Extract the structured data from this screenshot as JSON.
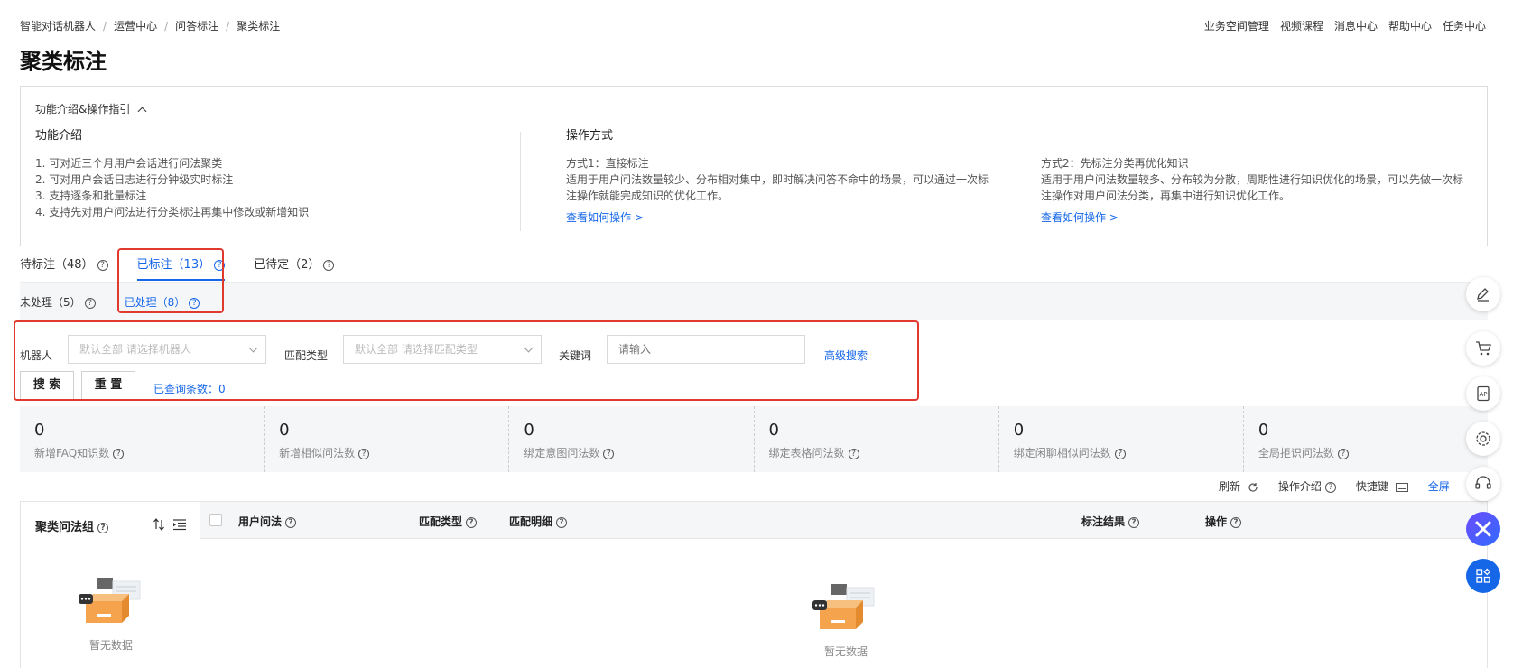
{
  "breadcrumb": [
    "智能对话机器人",
    "运营中心",
    "问答标注",
    "聚类标注"
  ],
  "top_links": [
    "业务空间管理",
    "视频课程",
    "消息中心",
    "帮助中心",
    "任务中心"
  ],
  "page_title": "聚类标注",
  "intro": {
    "toggle_label": "功能介绍&操作指引",
    "features": {
      "heading": "功能介绍",
      "items": [
        "1. 可对近三个月用户会话进行问法聚类",
        "2. 可对用户会话日志进行分钟级实时标注",
        "3. 支持逐条和批量标注",
        "4. 支持先对用户问法进行分类标注再集中修改或新增知识"
      ]
    },
    "operations": {
      "heading": "操作方式",
      "method1": {
        "title": "方式1：直接标注",
        "desc1": "适用于用户问法数量较少、分布相对集中，即时解决问答不命中的场景，可以通过一次标",
        "desc2": "注操作就能完成知识的优化工作。",
        "link": "查看如何操作 >"
      },
      "method2": {
        "title": "方式2：先标注分类再优化知识",
        "desc1": "适用于用户问法数量较多、分布较为分散，周期性进行知识优化的场景，可以先做一次标",
        "desc2": "注操作对用户问法分类，再集中进行知识优化工作。",
        "link": "查看如何操作 >"
      }
    }
  },
  "tabs_primary": [
    {
      "label": "待标注（48）",
      "active": false
    },
    {
      "label": "已标注（13）",
      "active": true
    },
    {
      "label": "已待定（2）",
      "active": false
    }
  ],
  "tabs_secondary": [
    {
      "label": "未处理（5）",
      "active": false
    },
    {
      "label": "已处理（8）",
      "active": true
    }
  ],
  "filters": {
    "robot_label": "机器人",
    "robot_placeholder": "默认全部 请选择机器人",
    "match_label": "匹配类型",
    "match_placeholder": "默认全部 请选择匹配类型",
    "keyword_label": "关键词",
    "keyword_placeholder": "请输入",
    "advanced_label": "高级搜索",
    "search_button": "搜 索",
    "reset_button": "重 置",
    "result_count": "已查询条数：0"
  },
  "stats": [
    {
      "value": "0",
      "label": "新增FAQ知识数"
    },
    {
      "value": "0",
      "label": "新增相似问法数"
    },
    {
      "value": "0",
      "label": "绑定意图问法数"
    },
    {
      "value": "0",
      "label": "绑定表格问法数"
    },
    {
      "value": "0",
      "label": "绑定闲聊相似问法数"
    },
    {
      "value": "0",
      "label": "全局拒识问法数"
    }
  ],
  "toolbar": {
    "refresh": "刷新",
    "op_intro": "操作介绍",
    "shortcut": "快捷键",
    "fullscreen": "全屏"
  },
  "cluster_panel": {
    "title": "聚类问法组",
    "empty_text": "暂无数据"
  },
  "table": {
    "columns": [
      "用户问法",
      "匹配类型",
      "匹配明细",
      "标注结果",
      "操作"
    ],
    "empty_text": "暂无数据"
  },
  "side_tools": [
    "edit-icon",
    "cart-icon",
    "api-doc-icon",
    "settings-icon",
    "headset-icon",
    "assistant-icon",
    "apps-icon"
  ],
  "colors": {
    "primary": "#1667e8",
    "highlight_border": "#e03a2f",
    "panel_bg": "#f5f6f8"
  }
}
